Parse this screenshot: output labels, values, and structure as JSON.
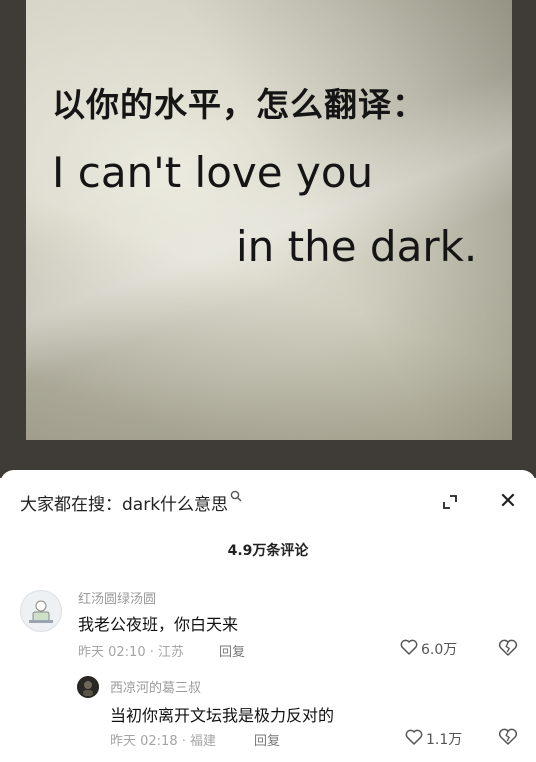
{
  "poster": {
    "question": "以你的水平，怎么翻译：",
    "line1": "I can't love you",
    "line2": "in the dark."
  },
  "search": {
    "label": "大家都在搜：dark什么意思",
    "icon": "search-icon"
  },
  "header_icons": {
    "expand": "expand-icon",
    "close": "close-icon",
    "close_glyph": "✕"
  },
  "comment_count": "4.9万条评论",
  "comments": [
    {
      "name": "红汤圆绿汤圆",
      "text": "我老公夜班，你白天来",
      "meta": "昨天 02:10 · 江苏",
      "reply": "回复",
      "likes": "6.0万"
    },
    {
      "name": "西凉河的葛三叔",
      "text": "当初你离开文坛我是极力反对的",
      "meta": "昨天 02:18 · 福建",
      "reply": "回复",
      "likes": "1.1万"
    }
  ],
  "colors": {
    "frame": "#3f3c37",
    "text": "#111111",
    "muted": "#9a9a9a"
  }
}
